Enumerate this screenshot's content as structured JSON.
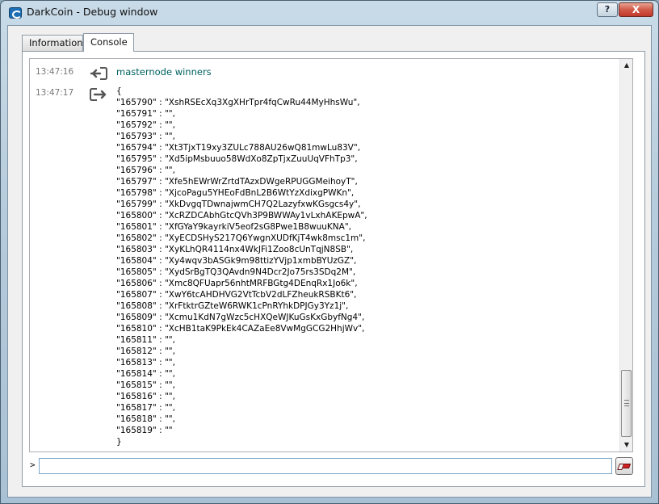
{
  "window": {
    "title": "DarkCoin - Debug window",
    "help_label": "?",
    "close_label": "X"
  },
  "tabs": [
    {
      "label": "Information"
    },
    {
      "label": "Console"
    }
  ],
  "console": {
    "entries": [
      {
        "time": "13:47:16",
        "kind": "request",
        "text": "masternode winners"
      },
      {
        "time": "13:47:17",
        "kind": "reply",
        "lines": [
          "{",
          "\"165790\" : \"XshRSEcXq3XgXHrTpr4fqCwRu44MyHhsWu\",",
          "\"165791\" : \"\",",
          "\"165792\" : \"\",",
          "\"165793\" : \"\",",
          "\"165794\" : \"Xt3TjxT19xy3ZULc788AU26wQ81mwLu83V\",",
          "\"165795\" : \"Xd5ipMsbuuo58WdXo8ZpTjxZuuUqVFhTp3\",",
          "\"165796\" : \"\",",
          "\"165797\" : \"Xfe5hEWrWrZrtdTAzxDWgeRPUGGMeihoyT\",",
          "\"165798\" : \"XjcoPagu5YHEoFdBnL2B6WtYzXdixgPWKn\",",
          "\"165799\" : \"XkDvgqTDwnajwmCH7Q2LazyfxwKGsgcs4y\",",
          "\"165800\" : \"XcRZDCAbhGtcQVh3P9BWWAy1vLxhAKEpwA\",",
          "\"165801\" : \"XfGYaY9kayrkiV5eof2sG8Pwe1B8wuuKNA\",",
          "\"165802\" : \"XyECDSHyS217Q6YwgnXUDfKjT4wk8msc1m\",",
          "\"165803\" : \"XyKLhQR4114nx4WkJFi1Zoo8cUnTqjN8SB\",",
          "\"165804\" : \"Xy4wqv3bASGk9m98ttizYVjp1xmbBYUzGZ\",",
          "\"165805\" : \"XydSrBgTQ3QAvdn9N4Dcr2Jo75rs3SDq2M\",",
          "\"165806\" : \"Xmc8QFUapr56nhtMRFBGtg4DEnqRx1Jo6k\",",
          "\"165807\" : \"XwY6tcAHDHVG2VtTcbV2dLFZheukRSBKt6\",",
          "\"165808\" : \"XrFtktrGZteW6RWK1cPnRYhkDPJGy3Yz1j\",",
          "\"165809\" : \"Xcmu1KdN7gWzc5cHXQeWJKuGsKxGbyfNg4\",",
          "\"165810\" : \"XcHB1taK9PkEk4CAZaEe8VwMgGCG2HhjWv\",",
          "\"165811\" : \"\",",
          "\"165812\" : \"\",",
          "\"165813\" : \"\",",
          "\"165814\" : \"\",",
          "\"165815\" : \"\",",
          "\"165816\" : \"\",",
          "\"165817\" : \"\",",
          "\"165818\" : \"\",",
          "\"165819\" : \"\"",
          "}"
        ]
      }
    ],
    "prompt": ">",
    "input_value": ""
  },
  "icons": {
    "request": "arrow-into-bracket-icon",
    "reply": "arrow-out-of-bracket-icon",
    "clear": "eraser-icon"
  },
  "colors": {
    "command_text": "#006060",
    "close_button": "#c0392b"
  }
}
